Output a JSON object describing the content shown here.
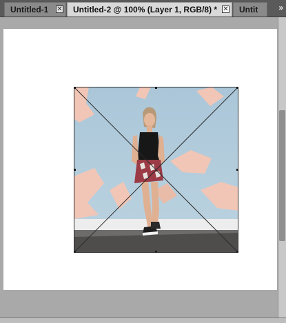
{
  "tabs": [
    {
      "label": "Untitled-1",
      "close": "✕",
      "active": false
    },
    {
      "label": "Untitled-2 @ 100% (Layer 1, RGB/8) *",
      "close": "✕",
      "active": true
    },
    {
      "label": "Untit",
      "active": false
    }
  ],
  "overflow_icon": "»",
  "colors": {
    "tabbar": "#5a5a5a",
    "active_tab": "#d9d9d9",
    "canvas": "#ffffff",
    "workspace": "#a9a9a9"
  }
}
